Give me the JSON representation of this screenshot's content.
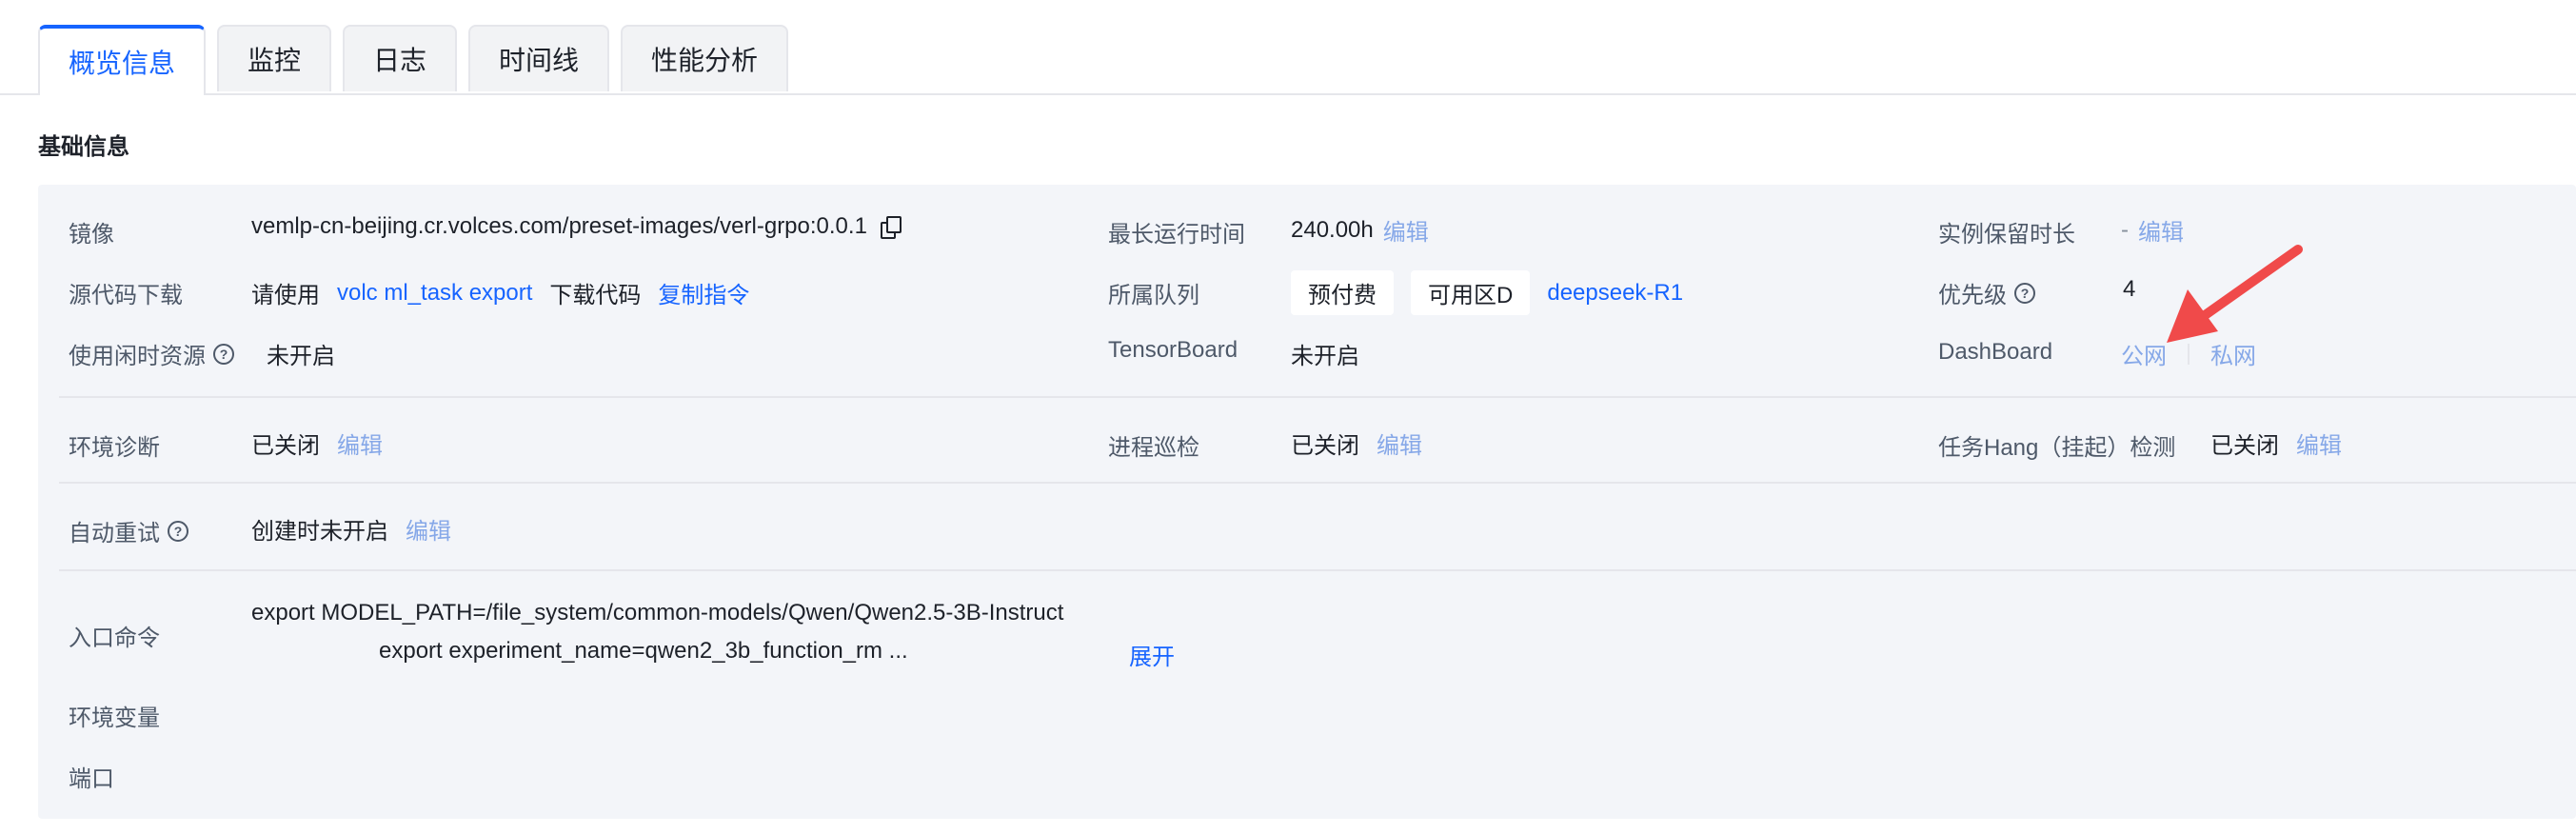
{
  "tabs": [
    "概览信息",
    "监控",
    "日志",
    "时间线",
    "性能分析"
  ],
  "section_title": "基础信息",
  "col1": {
    "image_label": "镜像",
    "image_value": "vemlp-cn-beijing.cr.volces.com/preset-images/verl-grpo:0.0.1",
    "source_label": "源代码下载",
    "source_prefix": "请使用",
    "source_cmd": "volc ml_task export",
    "source_suffix": "下载代码",
    "source_copy": "复制指令",
    "idle_label": "使用闲时资源",
    "idle_value": "未开启",
    "env_diag_label": "环境诊断",
    "env_diag_value": "已关闭",
    "auto_retry_label": "自动重试",
    "auto_retry_value": "创建时未开启",
    "entry_label": "入口命令",
    "entry_line1": "export MODEL_PATH=/file_system/common-models/Qwen/Qwen2.5-3B-Instruct",
    "entry_line2": "export experiment_name=qwen2_3b_function_rm ...",
    "entry_expand": "展开",
    "env_vars_label": "环境变量",
    "port_label": "端口"
  },
  "col2": {
    "max_runtime_label": "最长运行时间",
    "max_runtime_value": "240.00h",
    "queue_label": "所属队列",
    "queue_tag1": "预付费",
    "queue_tag2": "可用区D",
    "queue_link": "deepseek-R1",
    "tensorboard_label": "TensorBoard",
    "tensorboard_value": "未开启",
    "patrol_label": "进程巡检",
    "patrol_value": "已关闭"
  },
  "col3": {
    "retention_label": "实例保留时长",
    "retention_value": "-",
    "priority_label": "优先级",
    "priority_value": "4",
    "dashboard_label": "DashBoard",
    "dashboard_public": "公网",
    "dashboard_private": "私网",
    "hang_label": "任务Hang（挂起）检测",
    "hang_value": "已关闭"
  },
  "edit_label": "编辑",
  "colors": {
    "accent": "#1664ff",
    "panel": "#f3f5f9",
    "annotation_arrow": "#f04a4a"
  }
}
